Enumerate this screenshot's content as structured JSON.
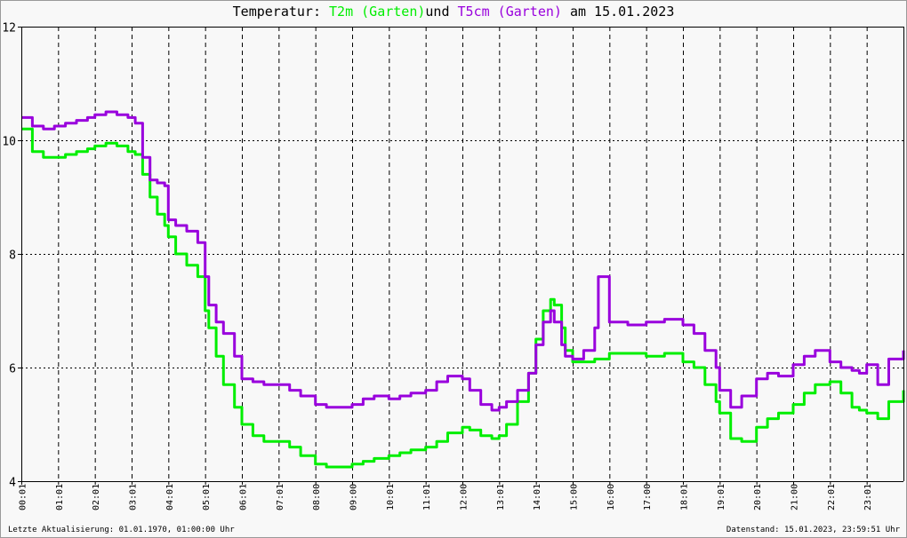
{
  "title": {
    "prefix": "Temperatur:",
    "series1": "T2m (Garten)",
    "middle": "und",
    "series2": "T5cm (Garten)",
    "suffix": "am 15.01.2023"
  },
  "footer": {
    "left": "Letzte Aktualisierung: 01.01.1970, 01:00:00 Uhr",
    "right": "Datenstand: 15.01.2023, 23:59:51 Uhr"
  },
  "colors": {
    "t2m": "#00ee00",
    "t5cm": "#9900dd",
    "grid": "#000000",
    "axis": "#000000"
  },
  "chart_data": {
    "type": "line",
    "title": "Temperatur: T2m (Garten) und T5cm (Garten) am 15.01.2023",
    "xlabel": "",
    "ylabel": "",
    "ylim": [
      4,
      12
    ],
    "xlim": [
      0,
      24
    ],
    "x_unit": "hours",
    "grid": true,
    "xticks": [
      "00:01",
      "01:01",
      "02:01",
      "03:01",
      "04:01",
      "05:01",
      "06:01",
      "07:01",
      "08:00",
      "09:00",
      "10:01",
      "11:01",
      "12:00",
      "13:01",
      "14:01",
      "15:00",
      "16:00",
      "17:00",
      "18:01",
      "19:01",
      "20:01",
      "21:00",
      "22:01",
      "23:01"
    ],
    "yticks": [
      "4",
      "6",
      "8",
      "10",
      "12"
    ],
    "series": [
      {
        "name": "T2m (Garten)",
        "color": "#00ee00",
        "x": [
          0,
          0.3,
          0.6,
          0.9,
          1.2,
          1.5,
          1.8,
          2.0,
          2.3,
          2.6,
          2.9,
          3.1,
          3.3,
          3.5,
          3.7,
          3.9,
          4.0,
          4.2,
          4.5,
          4.8,
          5.0,
          5.1,
          5.3,
          5.5,
          5.8,
          6.0,
          6.3,
          6.6,
          7.0,
          7.3,
          7.6,
          8.0,
          8.3,
          8.6,
          9.0,
          9.3,
          9.6,
          10.0,
          10.3,
          10.6,
          11.0,
          11.3,
          11.6,
          12.0,
          12.2,
          12.5,
          12.8,
          13.0,
          13.2,
          13.5,
          13.8,
          14.0,
          14.2,
          14.4,
          14.5,
          14.7,
          14.8,
          15.0,
          15.3,
          15.6,
          16.0,
          16.5,
          17.0,
          17.5,
          18.0,
          18.3,
          18.6,
          18.9,
          19.0,
          19.3,
          19.6,
          20.0,
          20.3,
          20.6,
          21.0,
          21.3,
          21.6,
          22.0,
          22.3,
          22.6,
          22.8,
          23.0,
          23.3,
          23.6,
          24.0
        ],
        "values": [
          10.2,
          9.8,
          9.7,
          9.7,
          9.75,
          9.8,
          9.85,
          9.9,
          9.95,
          9.9,
          9.8,
          9.75,
          9.4,
          9.0,
          8.7,
          8.5,
          8.3,
          8.0,
          7.8,
          7.6,
          7.0,
          6.7,
          6.2,
          5.7,
          5.3,
          5.0,
          4.8,
          4.7,
          4.7,
          4.6,
          4.45,
          4.3,
          4.25,
          4.25,
          4.3,
          4.35,
          4.4,
          4.45,
          4.5,
          4.55,
          4.6,
          4.7,
          4.85,
          4.95,
          4.9,
          4.8,
          4.75,
          4.8,
          5.0,
          5.4,
          5.9,
          6.5,
          7.0,
          7.2,
          7.1,
          6.7,
          6.3,
          6.1,
          6.1,
          6.15,
          6.25,
          6.25,
          6.2,
          6.25,
          6.1,
          6.0,
          5.7,
          5.4,
          5.2,
          4.75,
          4.7,
          4.95,
          5.1,
          5.2,
          5.35,
          5.55,
          5.7,
          5.75,
          5.55,
          5.3,
          5.25,
          5.2,
          5.1,
          5.4,
          5.6
        ]
      },
      {
        "name": "T5cm (Garten)",
        "color": "#9900dd",
        "x": [
          0,
          0.3,
          0.6,
          0.9,
          1.2,
          1.5,
          1.8,
          2.0,
          2.3,
          2.6,
          2.9,
          3.1,
          3.3,
          3.5,
          3.7,
          3.9,
          4.0,
          4.2,
          4.5,
          4.8,
          5.0,
          5.1,
          5.3,
          5.5,
          5.8,
          6.0,
          6.3,
          6.6,
          7.0,
          7.3,
          7.6,
          8.0,
          8.3,
          8.6,
          9.0,
          9.3,
          9.6,
          10.0,
          10.3,
          10.6,
          11.0,
          11.3,
          11.6,
          12.0,
          12.2,
          12.5,
          12.8,
          13.0,
          13.2,
          13.5,
          13.8,
          14.0,
          14.2,
          14.4,
          14.5,
          14.7,
          14.8,
          15.0,
          15.3,
          15.6,
          15.7,
          16.0,
          16.5,
          17.0,
          17.5,
          18.0,
          18.3,
          18.6,
          18.9,
          19.0,
          19.3,
          19.6,
          20.0,
          20.3,
          20.6,
          21.0,
          21.3,
          21.6,
          22.0,
          22.3,
          22.6,
          22.8,
          23.0,
          23.3,
          23.6,
          24.0
        ],
        "values": [
          10.4,
          10.25,
          10.2,
          10.25,
          10.3,
          10.35,
          10.4,
          10.45,
          10.5,
          10.45,
          10.4,
          10.3,
          9.7,
          9.3,
          9.25,
          9.2,
          8.6,
          8.5,
          8.4,
          8.2,
          7.6,
          7.1,
          6.8,
          6.6,
          6.2,
          5.8,
          5.75,
          5.7,
          5.7,
          5.6,
          5.5,
          5.35,
          5.3,
          5.3,
          5.35,
          5.45,
          5.5,
          5.45,
          5.5,
          5.55,
          5.6,
          5.75,
          5.85,
          5.8,
          5.6,
          5.35,
          5.25,
          5.3,
          5.4,
          5.6,
          5.9,
          6.4,
          6.8,
          7.0,
          6.8,
          6.4,
          6.2,
          6.15,
          6.3,
          6.7,
          7.6,
          6.8,
          6.75,
          6.8,
          6.85,
          6.75,
          6.6,
          6.3,
          6.0,
          5.6,
          5.3,
          5.5,
          5.8,
          5.9,
          5.85,
          6.05,
          6.2,
          6.3,
          6.1,
          6.0,
          5.95,
          5.9,
          6.05,
          5.7,
          6.15,
          6.3
        ]
      }
    ]
  }
}
